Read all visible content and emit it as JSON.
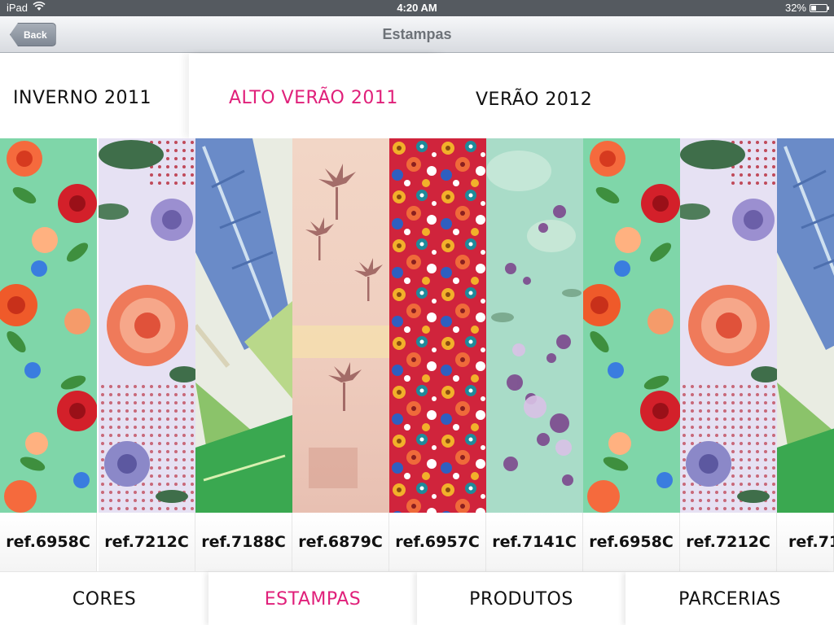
{
  "status_bar": {
    "device": "iPad",
    "time": "4:20 AM",
    "battery": "32%",
    "battery_level": 0.32,
    "icons": [
      "wifi-icon",
      "battery-icon"
    ]
  },
  "nav": {
    "back_label": "Back",
    "title": "Estampas"
  },
  "collections": [
    {
      "label": "INVERNO 2011",
      "active": false
    },
    {
      "label": "ALTO VERÃO 2011",
      "active": true
    },
    {
      "label": "VERÃO 2012",
      "active": false
    }
  ],
  "swatches": [
    {
      "ref": "ref.6958C",
      "pattern": "floral-green-roses"
    },
    {
      "ref": "ref.7212C",
      "pattern": "lavender-peony-dots"
    },
    {
      "ref": "ref.7188C",
      "pattern": "blue-feather-leaves"
    },
    {
      "ref": "ref.6879C",
      "pattern": "peach-palm-trees"
    },
    {
      "ref": "ref.6957C",
      "pattern": "ditsy-floral-red"
    },
    {
      "ref": "ref.7141C",
      "pattern": "mint-watercolor-purple"
    },
    {
      "ref": "ref.6958C",
      "pattern": "floral-green-roses"
    },
    {
      "ref": "ref.7212C",
      "pattern": "lavender-peony-dots"
    },
    {
      "ref": "ref.71",
      "pattern": "blue-feather-leaves"
    }
  ],
  "bottom_tabs": [
    {
      "label": "CORES",
      "active": false
    },
    {
      "label": "ESTAMPAS",
      "active": true
    },
    {
      "label": "PRODUTOS",
      "active": false
    },
    {
      "label": "PARCERIAS",
      "active": false
    }
  ],
  "colors": {
    "accent": "#e0207a",
    "text": "#111111",
    "status_bar": "#555a60"
  }
}
